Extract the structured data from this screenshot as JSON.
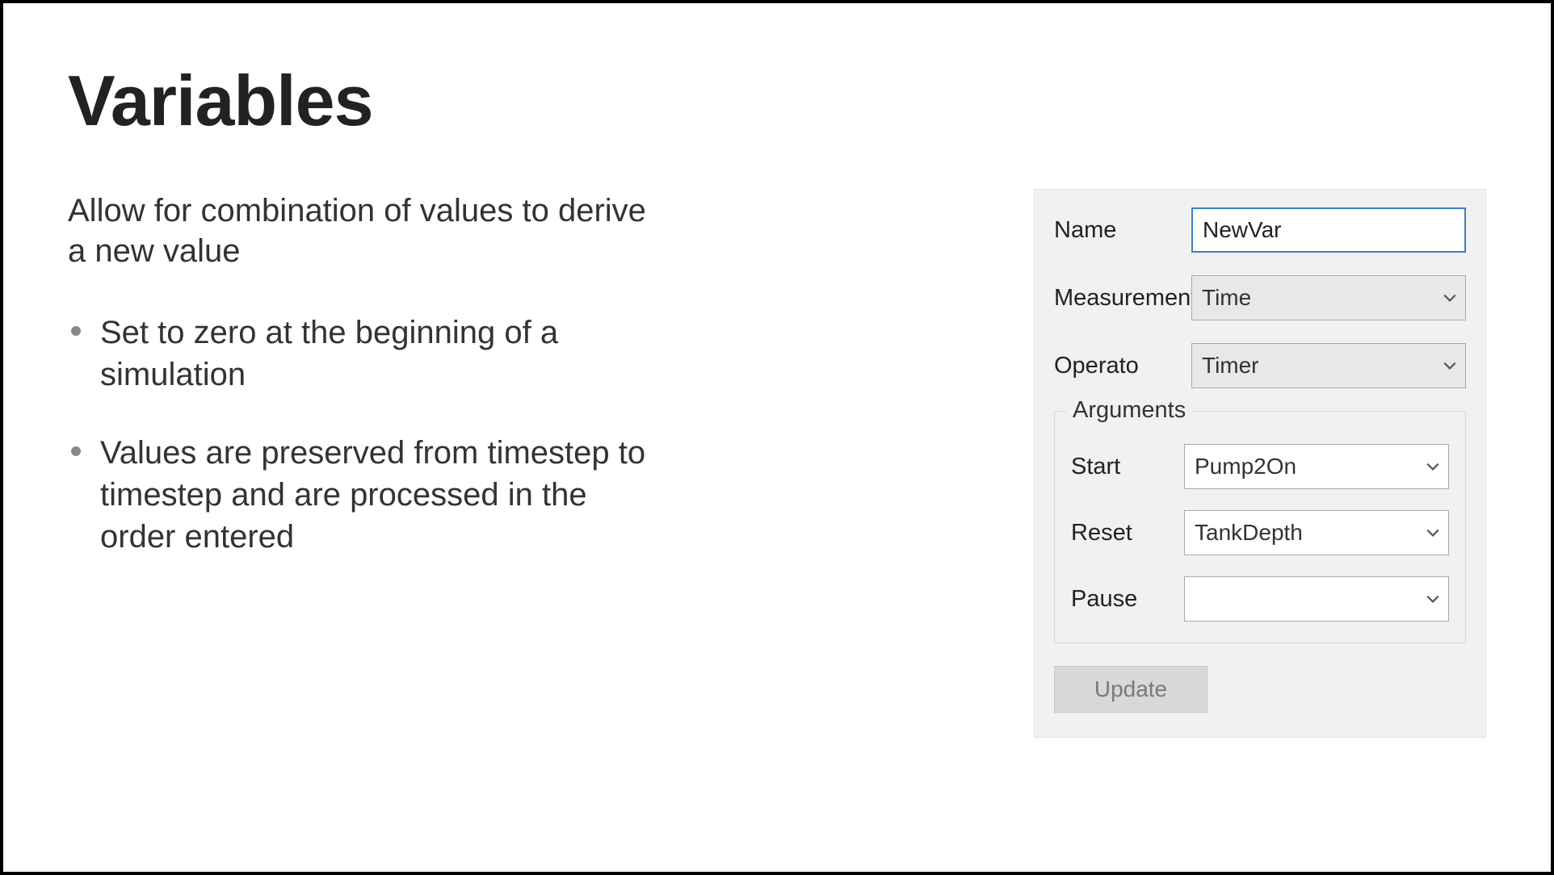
{
  "title": "Variables",
  "intro": "Allow for combination of values to derive a new value",
  "bullets": [
    "Set to zero at the beginning of a simulation",
    "Values are preserved from timestep to timestep and are processed in the order entered"
  ],
  "form": {
    "name_label": "Name",
    "name_value": "NewVar",
    "measurement_label": "Measurement",
    "measurement_value": "Time",
    "operator_label": "Operato",
    "operator_value": "Timer",
    "arguments_label": "Arguments",
    "start_label": "Start",
    "start_value": "Pump2On",
    "reset_label": "Reset",
    "reset_value": "TankDepth",
    "pause_label": "Pause",
    "pause_value": "",
    "update_label": "Update"
  }
}
